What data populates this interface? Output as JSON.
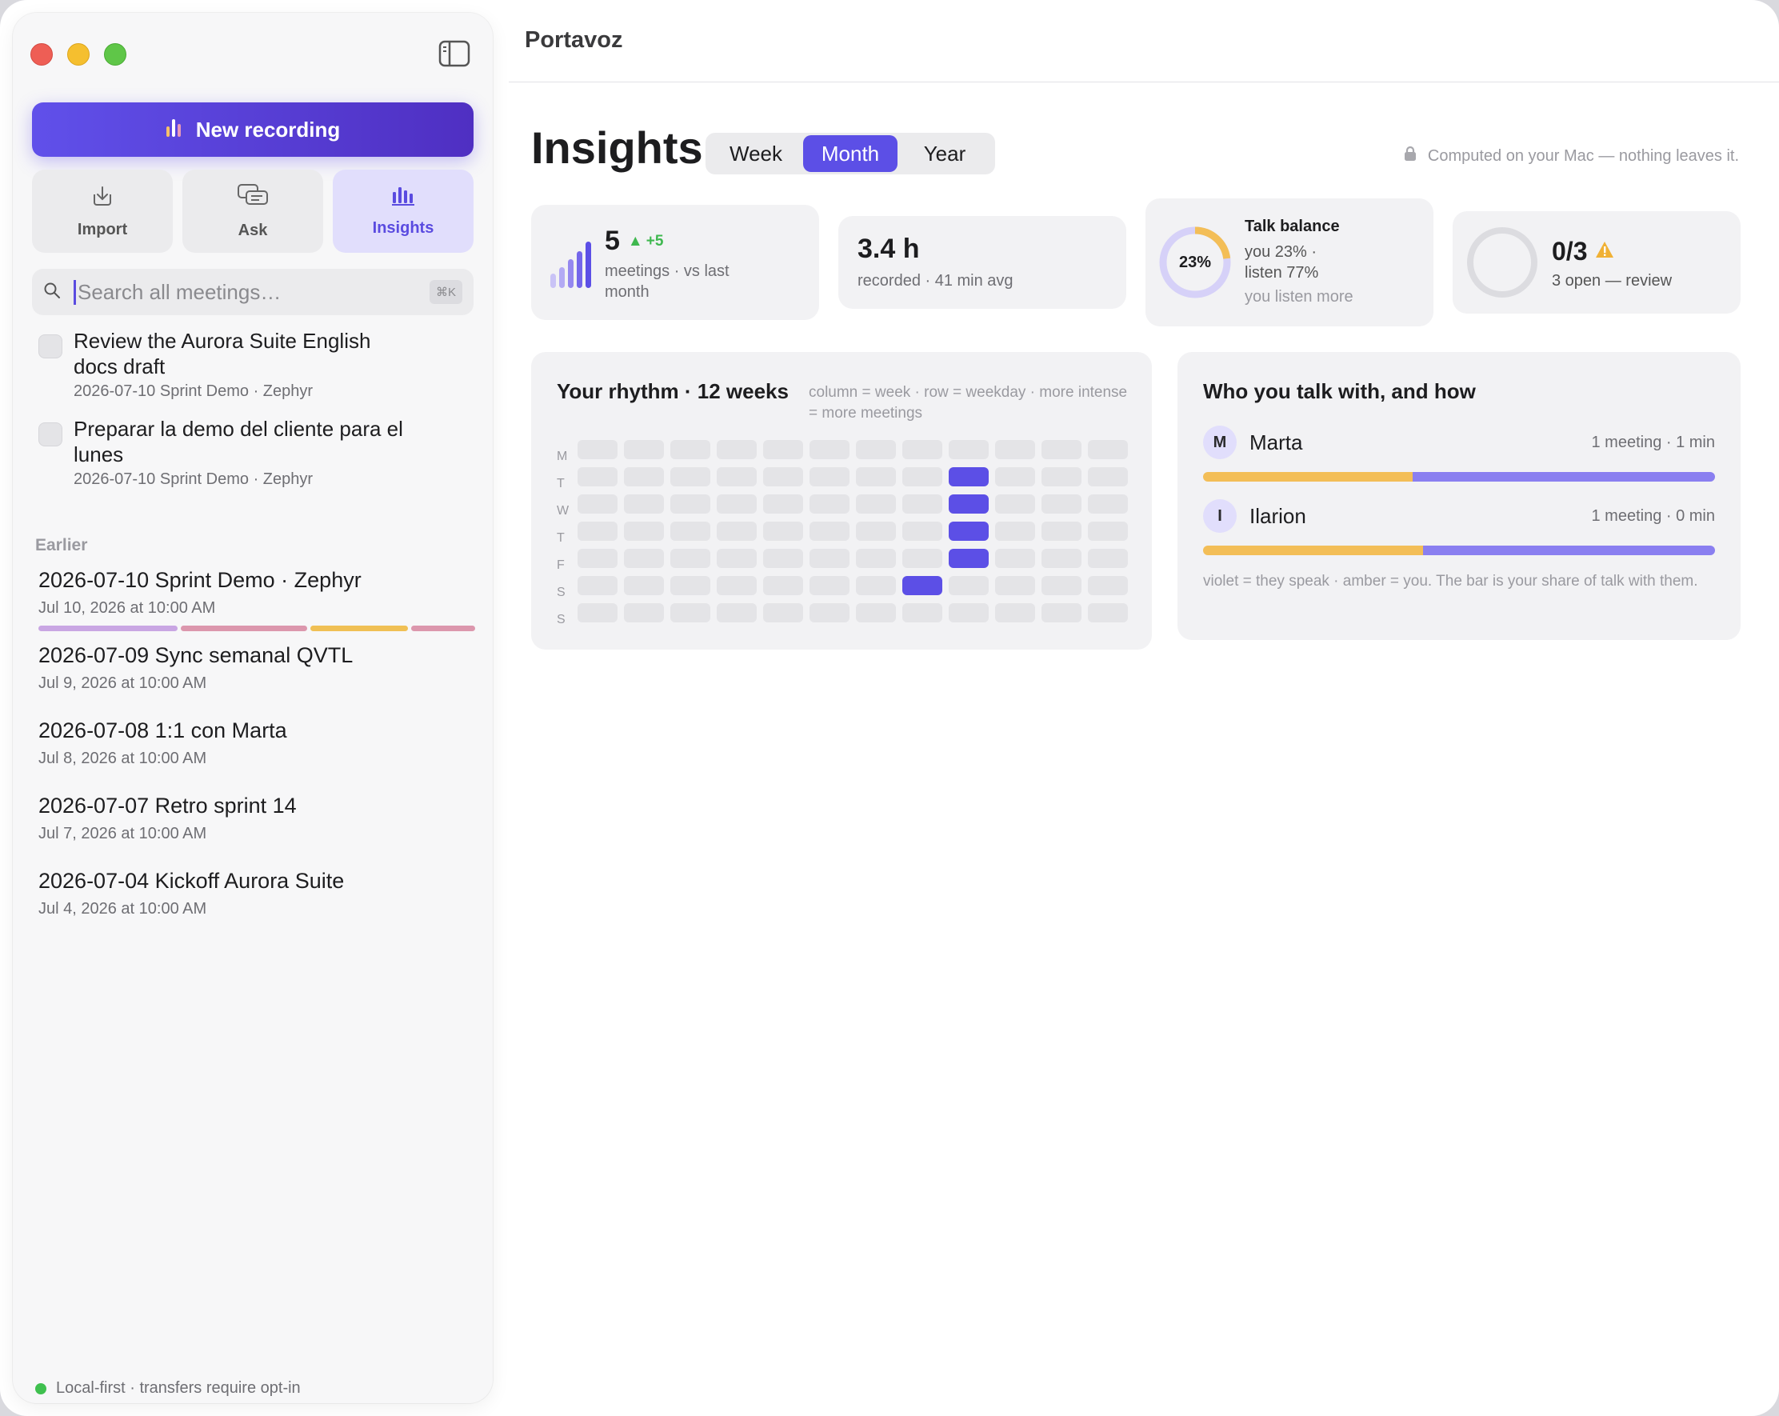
{
  "app": {
    "title": "Portavoz"
  },
  "sidebar": {
    "new_recording_label": "New recording",
    "tools": [
      {
        "label": "Import",
        "icon": "download-tray-icon"
      },
      {
        "label": "Ask",
        "icon": "chat-bubbles-icon"
      },
      {
        "label": "Insights",
        "icon": "bar-chart-icon",
        "active": true
      }
    ],
    "search": {
      "placeholder": "Search all meetings…",
      "shortcut": "⌘K"
    },
    "tasks": [
      {
        "title": "Review the Aurora Suite English docs draft",
        "meta": "2026-07-10 Sprint Demo · Zephyr",
        "done": false
      },
      {
        "title": "Preparar la demo del cliente para el lunes",
        "meta": "2026-07-10 Sprint Demo · Zephyr",
        "done": false
      }
    ],
    "section_label": "Earlier",
    "meetings": [
      {
        "title": "2026-07-10 Sprint Demo · Zephyr",
        "date": "Jul 10, 2026 at 10:00 AM",
        "segments": [
          "#c9a6e3",
          "#dc97ad",
          "#f0c055",
          "#dc97ad"
        ]
      },
      {
        "title": "2026-07-09 Sync semanal QVTL",
        "date": "Jul 9, 2026 at 10:00 AM"
      },
      {
        "title": "2026-07-08 1:1 con Marta",
        "date": "Jul 8, 2026 at 10:00 AM"
      },
      {
        "title": "2026-07-07 Retro sprint 14",
        "date": "Jul 7, 2026 at 10:00 AM"
      },
      {
        "title": "2026-07-04 Kickoff Aurora Suite",
        "date": "Jul 4, 2026 at 10:00 AM"
      }
    ],
    "footer": "Local-first · transfers require opt-in"
  },
  "insights": {
    "title": "Insights",
    "periods": [
      "Week",
      "Month",
      "Year"
    ],
    "active_period": "Month",
    "privacy_note": "Computed on your Mac — nothing leaves it.",
    "meetings_card": {
      "count": "5",
      "delta": "+5",
      "label": "meetings · vs last month"
    },
    "recorded_card": {
      "value": "3.4 h",
      "label": "recorded · 41 min avg"
    },
    "talk_card": {
      "percent": "23%",
      "you_share": 23,
      "title": "Talk balance",
      "line1": "you 23% ·",
      "line2": "listen 77%",
      "note": "you listen more"
    },
    "actions_card": {
      "value": "0/3",
      "label": "3 open — review",
      "completed_fraction": 0
    },
    "rhythm": {
      "title": "Your rhythm · 12 weeks",
      "note": "column = week · row = weekday · more intense = more meetings",
      "days": [
        "M",
        "T",
        "W",
        "T",
        "F",
        "S",
        "S"
      ],
      "weeks": 12,
      "active": [
        [
          1,
          8
        ],
        [
          2,
          8
        ],
        [
          3,
          8
        ],
        [
          4,
          8
        ],
        [
          5,
          7
        ]
      ]
    },
    "people": {
      "title": "Who you talk with, and how",
      "list": [
        {
          "initial": "M",
          "name": "Marta",
          "meta": "1 meeting · 1 min",
          "you_share": 0.41
        },
        {
          "initial": "I",
          "name": "Ilarion",
          "meta": "1 meeting · 0 min",
          "you_share": 0.43
        }
      ],
      "note": "violet = they speak · amber = you. The bar is your share of talk with them."
    }
  },
  "colors": {
    "accent": "#5c4fe6",
    "amber": "#f3be57",
    "violet": "#8a7ff0",
    "positive": "#3fb84f",
    "warning": "#f0b135"
  }
}
